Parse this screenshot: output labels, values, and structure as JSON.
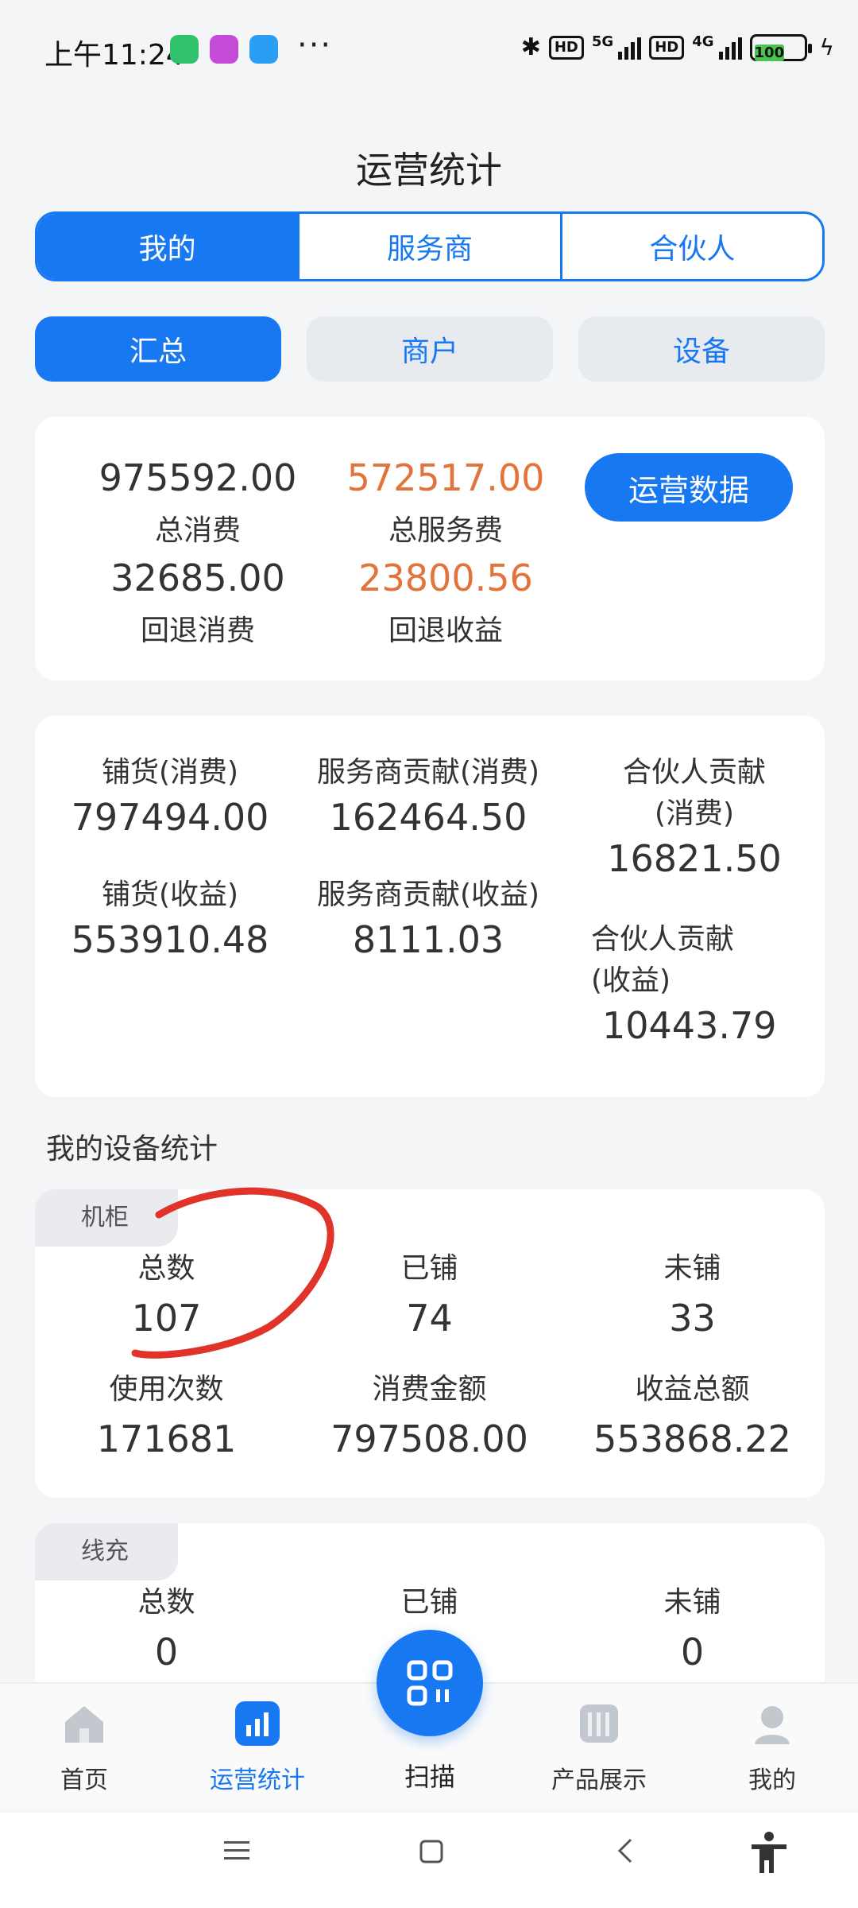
{
  "status_bar": {
    "time": "上午11:24",
    "network_1": "5G",
    "network_2": "4G",
    "hd": "HD",
    "battery": "100"
  },
  "header": {
    "title": "运营统计"
  },
  "role_tabs": [
    {
      "label": "我的",
      "active": true
    },
    {
      "label": "服务商",
      "active": false
    },
    {
      "label": "合伙人",
      "active": false
    }
  ],
  "sub_tabs": [
    {
      "label": "汇总",
      "active": true
    },
    {
      "label": "商户",
      "active": false
    },
    {
      "label": "设备",
      "active": false
    }
  ],
  "summary": {
    "total_consumption": {
      "value": "975592.00",
      "label": "总消费"
    },
    "total_service_fee": {
      "value": "572517.00",
      "label": "总服务费"
    },
    "refund_consumption": {
      "value": "32685.00",
      "label": "回退消费"
    },
    "refund_income": {
      "value": "23800.56",
      "label": "回退收益"
    },
    "ops_button": "运营数据"
  },
  "contribution": {
    "stock_consumption": {
      "label": "铺货(消费)",
      "value": "797494.00"
    },
    "provider_consumption": {
      "label": "服务商贡献(消费)",
      "value": "162464.50"
    },
    "partner_consumption": {
      "label_1": "合伙人贡献",
      "label_2": "(消费)",
      "value": "16821.50"
    },
    "stock_income": {
      "label": "铺货(收益)",
      "value": "553910.48"
    },
    "provider_income": {
      "label": "服务商贡献(收益)",
      "value": "8111.03"
    },
    "partner_income": {
      "label_1": "合伙人贡献",
      "label_2": "(收益)",
      "value": "10443.79"
    }
  },
  "device_section": {
    "title": "我的设备统计"
  },
  "cabinet": {
    "tag": "机柜",
    "total": {
      "label": "总数",
      "value": "107"
    },
    "deployed": {
      "label": "已铺",
      "value": "74"
    },
    "undeployed": {
      "label": "未铺",
      "value": "33"
    },
    "uses": {
      "label": "使用次数",
      "value": "171681"
    },
    "spend": {
      "label": "消费金额",
      "value": "797508.00"
    },
    "income": {
      "label": "收益总额",
      "value": "553868.22"
    }
  },
  "cable": {
    "tag": "线充",
    "total": {
      "label": "总数",
      "value": "0"
    },
    "deployed": {
      "label": "已铺",
      "value": ""
    },
    "undeployed": {
      "label": "未铺",
      "value": "0"
    }
  },
  "bottom_nav": {
    "home": "首页",
    "stats": "运营统计",
    "scan": "扫描",
    "products": "产品展示",
    "mine": "我的"
  },
  "colors": {
    "primary": "#1778f2",
    "orange": "#e2733a",
    "annotation": "#e0342a"
  }
}
